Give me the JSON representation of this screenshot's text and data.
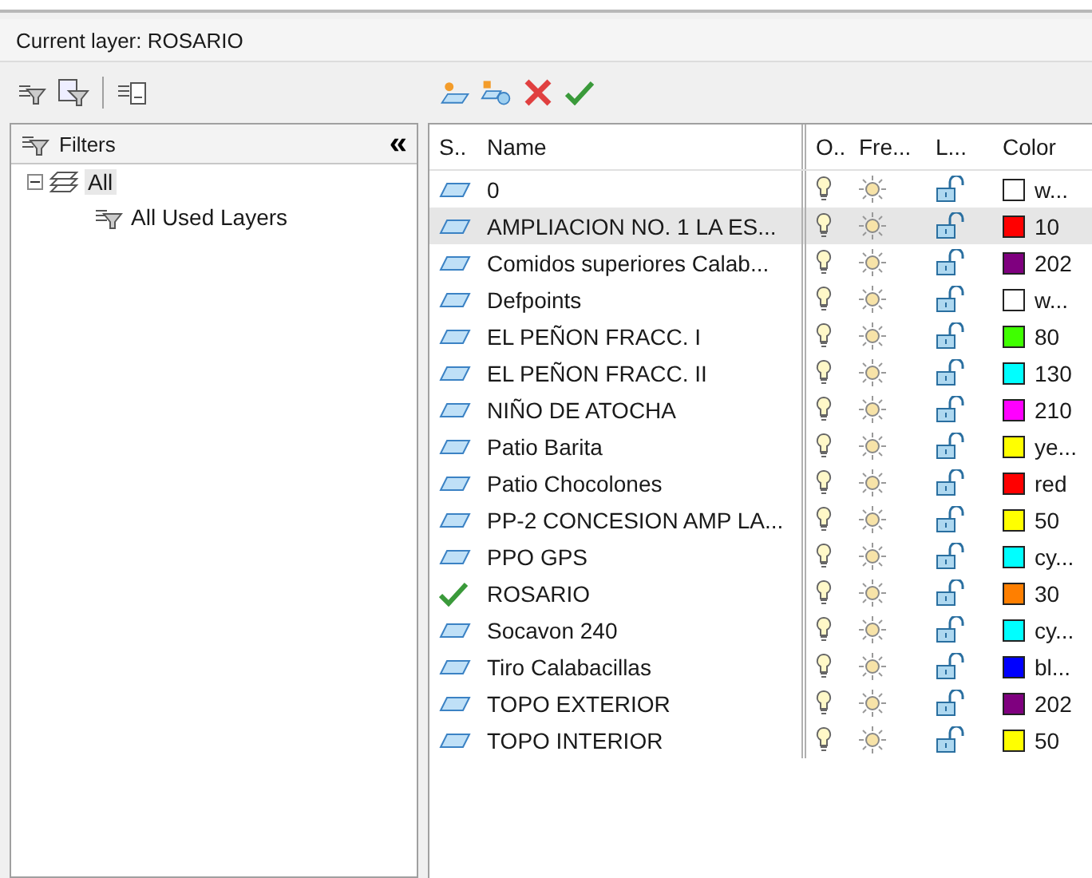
{
  "current_layer": "Current layer: ROSARIO",
  "filters": {
    "title": "Filters",
    "collapse": "«",
    "tree": [
      {
        "label": "All",
        "selected": true,
        "expanded": true,
        "children": [
          {
            "label": "All Used Layers",
            "selected": false
          }
        ]
      }
    ]
  },
  "columns": [
    "S..",
    "Name",
    "O..",
    "Fre...",
    "L...",
    "Color"
  ],
  "layers": [
    {
      "name": "0",
      "kind": "layer",
      "selected": false,
      "color": "#ffffff",
      "color_label": "w..."
    },
    {
      "name": "AMPLIACION NO. 1 LA ES...",
      "kind": "layer",
      "selected": true,
      "color": "#ff0000",
      "color_label": "10"
    },
    {
      "name": "Comidos superiores Calab...",
      "kind": "layer",
      "selected": false,
      "color": "#7f007f",
      "color_label": "202"
    },
    {
      "name": "Defpoints",
      "kind": "layer",
      "selected": false,
      "color": "#ffffff",
      "color_label": "w..."
    },
    {
      "name": "EL PEÑON FRACC. I",
      "kind": "layer",
      "selected": false,
      "color": "#3fff00",
      "color_label": "80"
    },
    {
      "name": "EL PEÑON FRACC. II",
      "kind": "layer",
      "selected": false,
      "color": "#00ffff",
      "color_label": "130"
    },
    {
      "name": "NIÑO DE ATOCHA",
      "kind": "layer",
      "selected": false,
      "color": "#ff00ff",
      "color_label": "210"
    },
    {
      "name": "Patio Barita",
      "kind": "layer",
      "selected": false,
      "color": "#ffff00",
      "color_label": "ye..."
    },
    {
      "name": "Patio Chocolones",
      "kind": "layer",
      "selected": false,
      "color": "#ff0000",
      "color_label": "red"
    },
    {
      "name": "PP-2 CONCESION AMP LA...",
      "kind": "layer",
      "selected": false,
      "color": "#ffff00",
      "color_label": "50"
    },
    {
      "name": "PPO GPS",
      "kind": "layer",
      "selected": false,
      "color": "#00ffff",
      "color_label": "cy..."
    },
    {
      "name": "ROSARIO",
      "kind": "current",
      "selected": false,
      "color": "#ff7f00",
      "color_label": "30"
    },
    {
      "name": "Socavon 240",
      "kind": "layer",
      "selected": false,
      "color": "#00ffff",
      "color_label": "cy..."
    },
    {
      "name": "Tiro Calabacillas",
      "kind": "layer",
      "selected": false,
      "color": "#0000ff",
      "color_label": "bl..."
    },
    {
      "name": "TOPO EXTERIOR",
      "kind": "layer",
      "selected": false,
      "color": "#7f007f",
      "color_label": "202"
    },
    {
      "name": "TOPO INTERIOR",
      "kind": "layer",
      "selected": false,
      "color": "#ffff00",
      "color_label": "50"
    }
  ]
}
